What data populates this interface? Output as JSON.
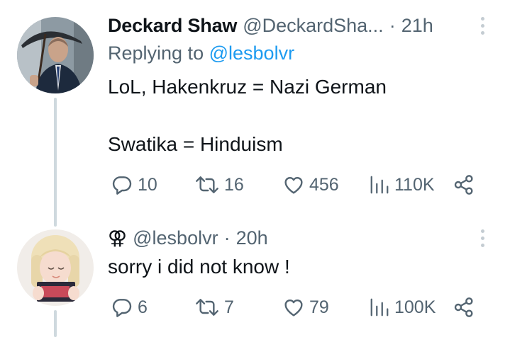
{
  "tweets": [
    {
      "author_name": "Deckard Shaw",
      "handle": "@DeckardSha...",
      "separator": "·",
      "time": "21h",
      "replying_prefix": "Replying to",
      "replying_to": "@lesbolvr",
      "text_lines": [
        "LoL, Hakenkruz = Nazi German",
        "Swatika = Hinduism"
      ],
      "stats": {
        "replies": "10",
        "retweets": "16",
        "likes": "456",
        "views": "110K"
      },
      "avatar_icon": "avatar-man-with-umbrella"
    },
    {
      "author_symbol": "⚢",
      "handle": "@lesbolvr",
      "separator": "·",
      "time": "20h",
      "text_lines": [
        "sorry i did not know !"
      ],
      "stats": {
        "replies": "6",
        "retweets": "7",
        "likes": "79",
        "views": "100K"
      },
      "avatar_icon": "avatar-blonde-girl"
    }
  ],
  "icons": [
    "reply-icon",
    "retweet-icon",
    "like-icon",
    "views-icon",
    "share-icon",
    "more-icon"
  ],
  "colors": {
    "text": "#0f1419",
    "secondary": "#536471",
    "link": "#1d9bf0",
    "thread_line": "#cfd9de"
  }
}
